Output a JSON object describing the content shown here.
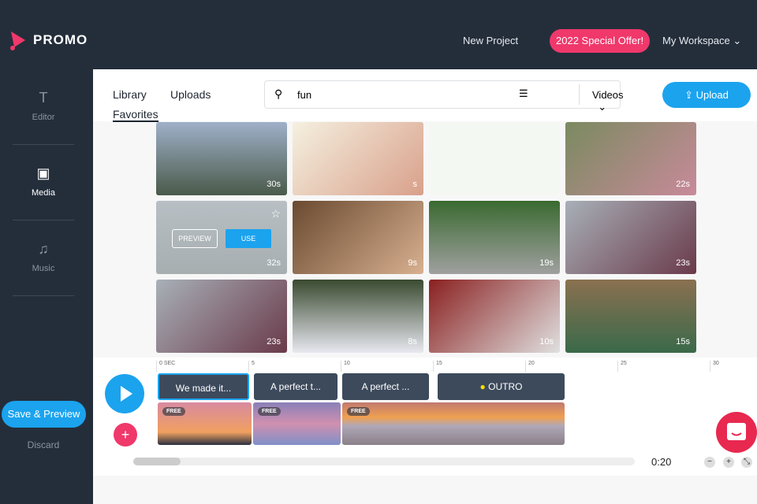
{
  "header": {
    "brand": "PROMO",
    "new_project": "New Project",
    "offer": "2022 Special Offer!",
    "workspace": "My Workspace"
  },
  "sidebar": {
    "items": [
      {
        "label": "Editor"
      },
      {
        "label": "Media"
      },
      {
        "label": "Music"
      }
    ],
    "save_preview": "Save & Preview",
    "discard": "Discard"
  },
  "library": {
    "tabs": [
      "Library",
      "Uploads",
      "Favorites"
    ],
    "search_value": "fun",
    "media_type": "Videos",
    "upload": "Upload"
  },
  "grid": {
    "durations": [
      "30s",
      "s",
      "",
      "22s",
      "32s",
      "9s",
      "19s",
      "23s",
      "23s",
      "8s",
      "10s",
      "15s"
    ],
    "preview": "PREVIEW",
    "use": "USE"
  },
  "timeline": {
    "ticks": [
      "0 SEC",
      "5",
      "10",
      "15",
      "20",
      "25",
      "30"
    ],
    "clips": [
      "We made it...",
      "A perfect t...",
      "A perfect ...",
      "OUTRO"
    ],
    "free": "FREE",
    "time": "0:20"
  },
  "colors": {
    "accent": "#1ba3ee",
    "brand": "#f0386b",
    "dark": "#242e3b"
  }
}
